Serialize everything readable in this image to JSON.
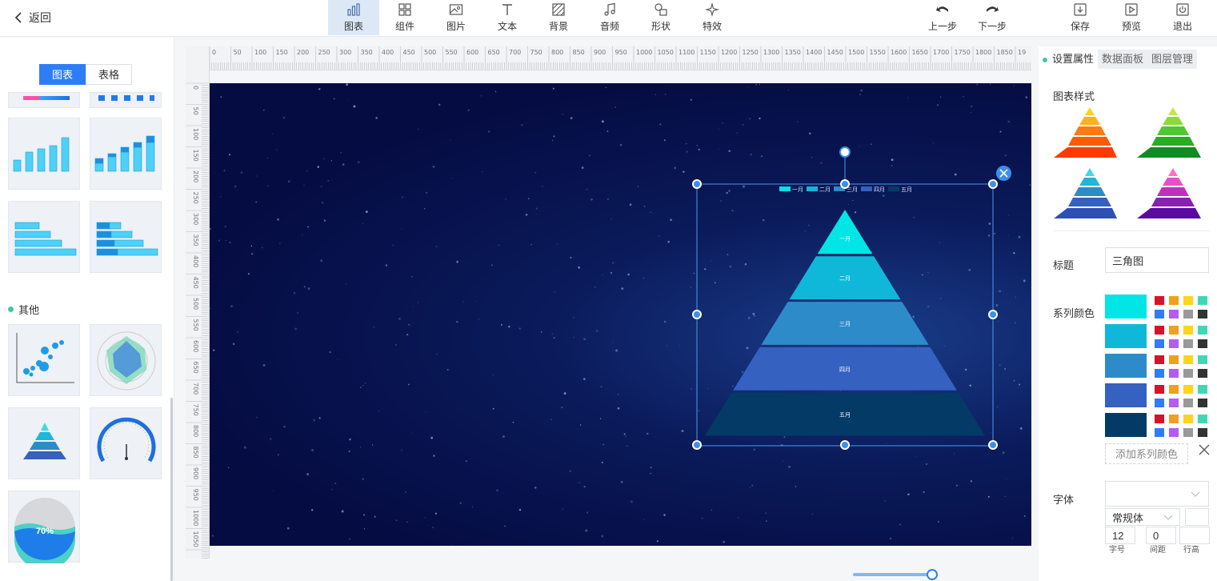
{
  "topbar": {
    "back_label": "返回",
    "tools": [
      {
        "label": "图表",
        "icon": "bar-chart-icon"
      },
      {
        "label": "组件",
        "icon": "grid-icon"
      },
      {
        "label": "图片",
        "icon": "image-icon"
      },
      {
        "label": "文本",
        "icon": "text-icon"
      },
      {
        "label": "背景",
        "icon": "background-icon"
      },
      {
        "label": "音频",
        "icon": "music-icon"
      },
      {
        "label": "形状",
        "icon": "shape-icon"
      },
      {
        "label": "特效",
        "icon": "sparkle-icon"
      }
    ],
    "undo_label": "上一步",
    "redo_label": "下一步",
    "save_label": "保存",
    "preview_label": "预览",
    "exit_label": "退出"
  },
  "left": {
    "tab_chart": "图表",
    "tab_table": "表格",
    "section_other": "其他",
    "gauge_percent": "70%"
  },
  "ruler": {
    "top_ticks": [
      "0",
      "50",
      "100",
      "150",
      "200",
      "250",
      "300",
      "350",
      "400",
      "450",
      "500",
      "550",
      "600",
      "650",
      "700",
      "750",
      "800",
      "850",
      "900",
      "950",
      "1000",
      "1050",
      "1100",
      "1150",
      "1200",
      "1250",
      "1300",
      "1350",
      "1400",
      "1450",
      "1500",
      "1550",
      "1600",
      "1650",
      "1700",
      "1750",
      "1800",
      "1850",
      "19"
    ],
    "left_ticks": [
      "0",
      "50",
      "100",
      "150",
      "200",
      "250",
      "300",
      "350",
      "400",
      "450",
      "500",
      "550",
      "600",
      "650",
      "700",
      "750",
      "800",
      "850",
      "900",
      "950",
      "1000",
      "1050"
    ]
  },
  "chart_data": {
    "type": "pyramid",
    "legend": [
      "一月",
      "二月",
      "三月",
      "四月",
      "五月"
    ],
    "layers": [
      "一月",
      "二月",
      "三月",
      "四月",
      "五月"
    ],
    "colors": [
      "#00e5e5",
      "#0fb8d8",
      "#2e8bc9",
      "#3561c0",
      "#043a66"
    ]
  },
  "right": {
    "tab_settings": "设置属性",
    "tab_data": "数据面板",
    "tab_layers": "图层管理",
    "chart_style_label": "图表样式",
    "title_label": "标题",
    "title_value": "三角图",
    "series_color_label": "系列颜色",
    "series_colors": [
      "#00e5e5",
      "#0fb8d8",
      "#2e8bc9",
      "#3561c0",
      "#043a66"
    ],
    "palette": [
      "#d4142a",
      "#f0a020",
      "#ffd41a",
      "#40d8b4",
      "#2f7df6",
      "#b45cf0",
      "#999999",
      "#333333"
    ],
    "add_color_label": "添加系列颜色",
    "font_label": "字体",
    "font_style_value": "常规体",
    "font_size_value": "12",
    "font_size_label": "字号",
    "spacing_value": "0",
    "spacing_label": "间距",
    "line_height_label": "行高"
  }
}
